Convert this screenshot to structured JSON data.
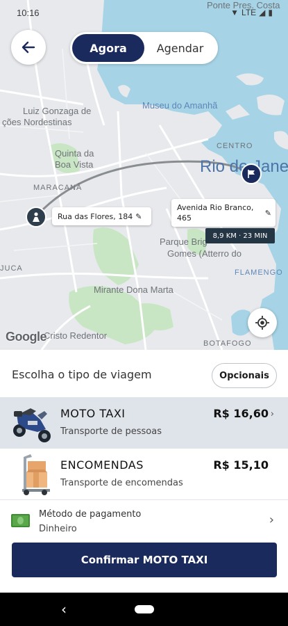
{
  "status_bar": {
    "time": "10:16",
    "network": "LTE"
  },
  "map": {
    "labels": {
      "ponte": "Ponte Pres. Costa",
      "museu": "Museu do Amanhã",
      "luiz1": "Luiz Gonzaga de",
      "luiz2": "ções Nordestinas",
      "quinta1": "Quinta da",
      "quinta2": "Boa Vista",
      "centro": "CENTRO",
      "rio": "Rio de Jane",
      "maracana": "MARACANÃ",
      "parque1": "Parque Brig",
      "parque2": "Gomes (Atterro do",
      "flamengo": "FLAMENGO",
      "mirante": "Mirante Dona Marta",
      "juca": "JUCA",
      "cristo": "Cristo Redentor",
      "botafogo": "BOTAFOGO"
    },
    "origin_address": "Rua das Flores, 184",
    "destination_address": "Avenida Rio Branco, 465",
    "eta": "8,9 KM · 23 MIN",
    "attribution": "Google"
  },
  "tabs": {
    "now": "Agora",
    "schedule": "Agendar"
  },
  "sheet": {
    "title": "Escolha o tipo de viagem",
    "options_button": "Opcionais",
    "rides": [
      {
        "name": "MOTO TAXI",
        "description": "Transporte de pessoas",
        "price": "R$ 16,60",
        "selected": true,
        "icon": "motorcycle-icon"
      },
      {
        "name": "ENCOMENDAS",
        "description": "Transporte de encomendas",
        "price": "R$ 15,10",
        "selected": false,
        "icon": "package-icon"
      }
    ],
    "payment": {
      "label": "Método de pagamento",
      "value": "Dinheiro",
      "icon": "cash-icon"
    },
    "confirm_button": "Confirmar MOTO TAXI"
  },
  "colors": {
    "primary": "#1b2a5c",
    "water": "#a6d4e6",
    "park": "#c8e6c4",
    "selected_row": "#dfe3ea"
  }
}
